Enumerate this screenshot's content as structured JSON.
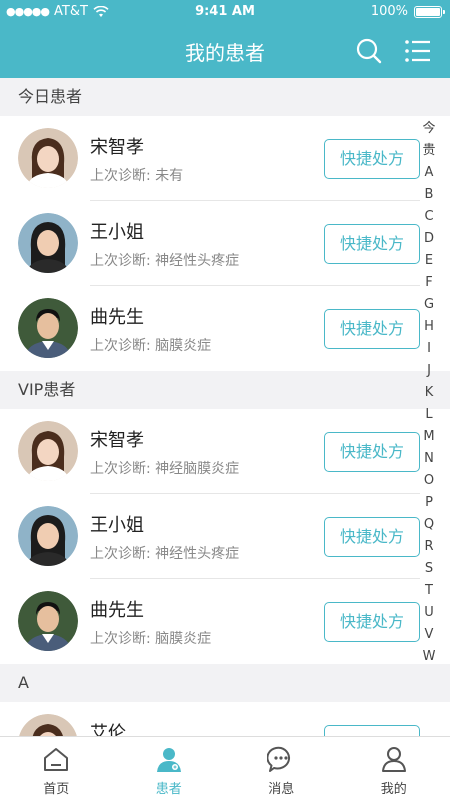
{
  "status_bar": {
    "carrier": "AT&T",
    "time": "9:41 AM",
    "battery": "100%"
  },
  "nav": {
    "title": "我的患者",
    "search_icon": "search-icon",
    "menu_icon": "list-menu-icon"
  },
  "sections": [
    {
      "header": "今日患者",
      "patients": [
        {
          "name": "宋智孝",
          "diag_label": "上次诊断:",
          "diagnosis": "未有",
          "button": "快捷处方",
          "avatar": "woman-1"
        },
        {
          "name": "王小姐",
          "diag_label": "上次诊断:",
          "diagnosis": "神经性头疼症",
          "button": "快捷处方",
          "avatar": "woman-2"
        },
        {
          "name": "曲先生",
          "diag_label": "上次诊断:",
          "diagnosis": "脑膜炎症",
          "button": "快捷处方",
          "avatar": "man-1"
        }
      ]
    },
    {
      "header": "VIP患者",
      "patients": [
        {
          "name": "宋智孝",
          "diag_label": "上次诊断:",
          "diagnosis": "神经脑膜炎症",
          "button": "快捷处方",
          "avatar": "woman-1"
        },
        {
          "name": "王小姐",
          "diag_label": "上次诊断:",
          "diagnosis": "神经性头疼症",
          "button": "快捷处方",
          "avatar": "woman-2"
        },
        {
          "name": "曲先生",
          "diag_label": "上次诊断:",
          "diagnosis": "脑膜炎症",
          "button": "快捷处方",
          "avatar": "man-1"
        }
      ]
    },
    {
      "header": "A",
      "patients": [
        {
          "name": "艾伦",
          "diag_label": "",
          "diagnosis": "",
          "button": "快捷处方",
          "avatar": "woman-1"
        }
      ]
    }
  ],
  "alpha_index": [
    "今",
    "贵",
    "A",
    "B",
    "C",
    "D",
    "E",
    "F",
    "G",
    "H",
    "I",
    "J",
    "K",
    "L",
    "M",
    "N",
    "O",
    "P",
    "Q",
    "R",
    "S",
    "T",
    "U",
    "V",
    "W"
  ],
  "tabs": [
    {
      "label": "首页",
      "icon": "home-icon",
      "active": false
    },
    {
      "label": "患者",
      "icon": "patient-icon",
      "active": true
    },
    {
      "label": "消息",
      "icon": "message-icon",
      "active": false
    },
    {
      "label": "我的",
      "icon": "profile-icon",
      "active": false
    }
  ],
  "colors": {
    "accent": "#4ab8c8",
    "background": "#f2f2f4"
  }
}
